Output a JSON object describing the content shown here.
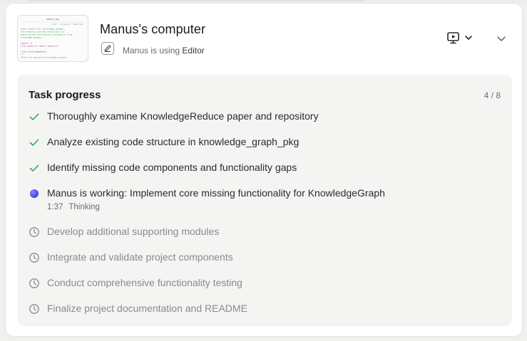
{
  "header": {
    "title": "Manus's computer",
    "using_prefix": "Manus is using",
    "using_app": "Editor",
    "app_icon": "pen-editor-icon",
    "display_icon": "monitor-play-icon",
    "display_caret_icon": "chevron-down-icon",
    "collapse_icon": "chevron-down-icon"
  },
  "thumbnail": {
    "filename": "query.py",
    "tabs": [
      "Diff",
      "Original",
      "Modified"
    ],
    "lines": [
      "Query module for knowledge graphs.",
      "This module provides functions for",
      "querying and extracting information from",
      "knowledge graphs.",
      "",
      "import re",
      "from question import question",
      "",
      "class KnowledgeQuery",
      "    \"\"\"",
      "    Class for querying knowledge graphs."
    ]
  },
  "task_progress": {
    "title": "Task progress",
    "count": "4 / 8",
    "items": [
      {
        "label": "Thoroughly examine KnowledgeReduce paper and repository",
        "status": "done",
        "icon": "check-icon"
      },
      {
        "label": "Analyze existing code structure in knowledge_graph_pkg",
        "status": "done",
        "icon": "check-icon"
      },
      {
        "label": "Identify missing code components and functionality gaps",
        "status": "done",
        "icon": "check-icon"
      },
      {
        "label": "Manus is working: Implement core missing functionality for KnowledgeGraph",
        "status": "active",
        "icon": "working-dot-icon"
      },
      {
        "label": "Develop additional supporting modules",
        "status": "pending",
        "icon": "clock-icon"
      },
      {
        "label": "Integrate and validate project components",
        "status": "pending",
        "icon": "clock-icon"
      },
      {
        "label": "Conduct comprehensive functionality testing",
        "status": "pending",
        "icon": "clock-icon"
      },
      {
        "label": "Finalize project documentation and README",
        "status": "pending",
        "icon": "clock-icon"
      }
    ],
    "active_elapsed": "1:37",
    "active_state": "Thinking"
  },
  "colors": {
    "check": "#2fa84f",
    "pending_icon": "#8a8a8a",
    "active_dot": "#4b4ff0",
    "panel_bg": "#f4f4f3"
  }
}
